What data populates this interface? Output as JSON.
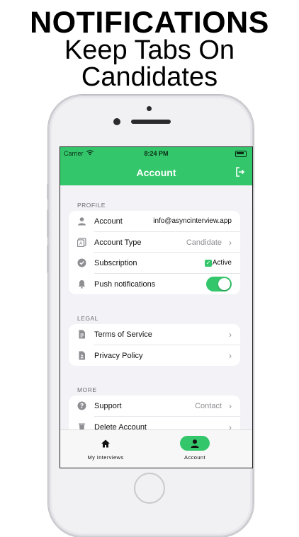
{
  "promo": {
    "headline": "NOTIFICATIONS",
    "line2": "Keep Tabs On",
    "line3": "Candidates"
  },
  "status_bar": {
    "carrier": "Carrier",
    "time": "8:24 PM"
  },
  "nav": {
    "title": "Account"
  },
  "sections": {
    "profile": {
      "header": "PROFILE",
      "account_label": "Account",
      "account_value": "info@asyncinterview.app",
      "account_type_label": "Account Type",
      "account_type_value": "Candidate",
      "subscription_label": "Subscription",
      "subscription_value": "Active",
      "push_label": "Push notifications",
      "push_enabled": true
    },
    "legal": {
      "header": "LEGAL",
      "terms_label": "Terms of Service",
      "privacy_label": "Privacy Policy"
    },
    "more": {
      "header": "MORE",
      "support_label": "Support",
      "support_value": "Contact",
      "delete_label": "Delete Account"
    }
  },
  "tabs": [
    {
      "label": "My Interviews",
      "icon": "house-icon",
      "active": false
    },
    {
      "label": "Account",
      "icon": "person-icon",
      "active": true
    }
  ],
  "colors": {
    "accent": "#34c66b",
    "background": "#f2f2f7"
  }
}
